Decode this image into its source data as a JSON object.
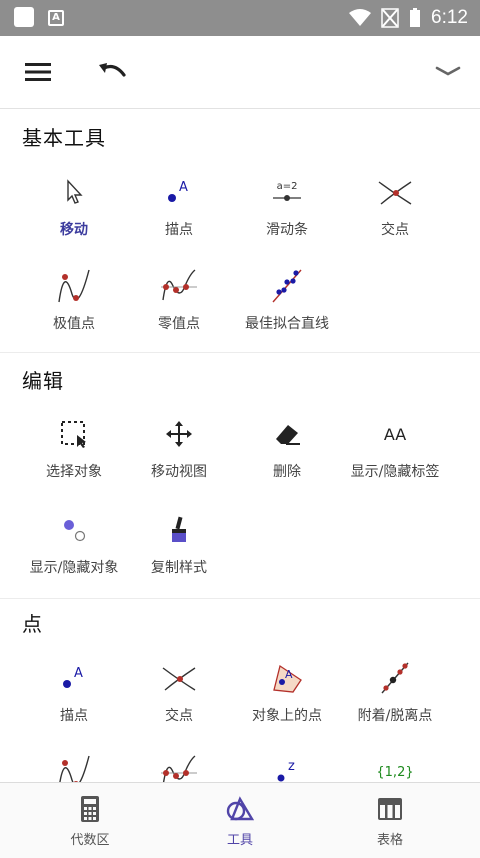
{
  "status_bar": {
    "time": "6:12",
    "notification_letter": "A"
  },
  "toolbar": {
    "menu": "menu",
    "undo": "undo",
    "collapse": "collapse"
  },
  "sections": {
    "basic": {
      "title": "基本工具",
      "tools": [
        "移动",
        "描点",
        "滑动条",
        "交点",
        "极值点",
        "零值点",
        "最佳拟合直线"
      ],
      "slider_icon_text": "a=2"
    },
    "edit": {
      "title": "编辑",
      "tools": [
        "选择对象",
        "移动视图",
        "删除",
        "显示/隐藏标签",
        "显示/隐藏对象",
        "复制样式"
      ],
      "label_icon_text": "AA"
    },
    "points": {
      "title": "点",
      "tools": [
        "描点",
        "交点",
        "对象上的点",
        "附着/脱离点"
      ],
      "point_icon_text": "A",
      "complex_icon_text": "z",
      "list_icon_text": "{1,2}"
    }
  },
  "bottom_nav": {
    "items": [
      "代数区",
      "工具",
      "表格"
    ],
    "active": "工具"
  },
  "colors": {
    "accent": "#5145a8",
    "point_blue": "#1a1aa6",
    "point_red": "#b3302a",
    "statusbar": "#8e8e8e"
  }
}
